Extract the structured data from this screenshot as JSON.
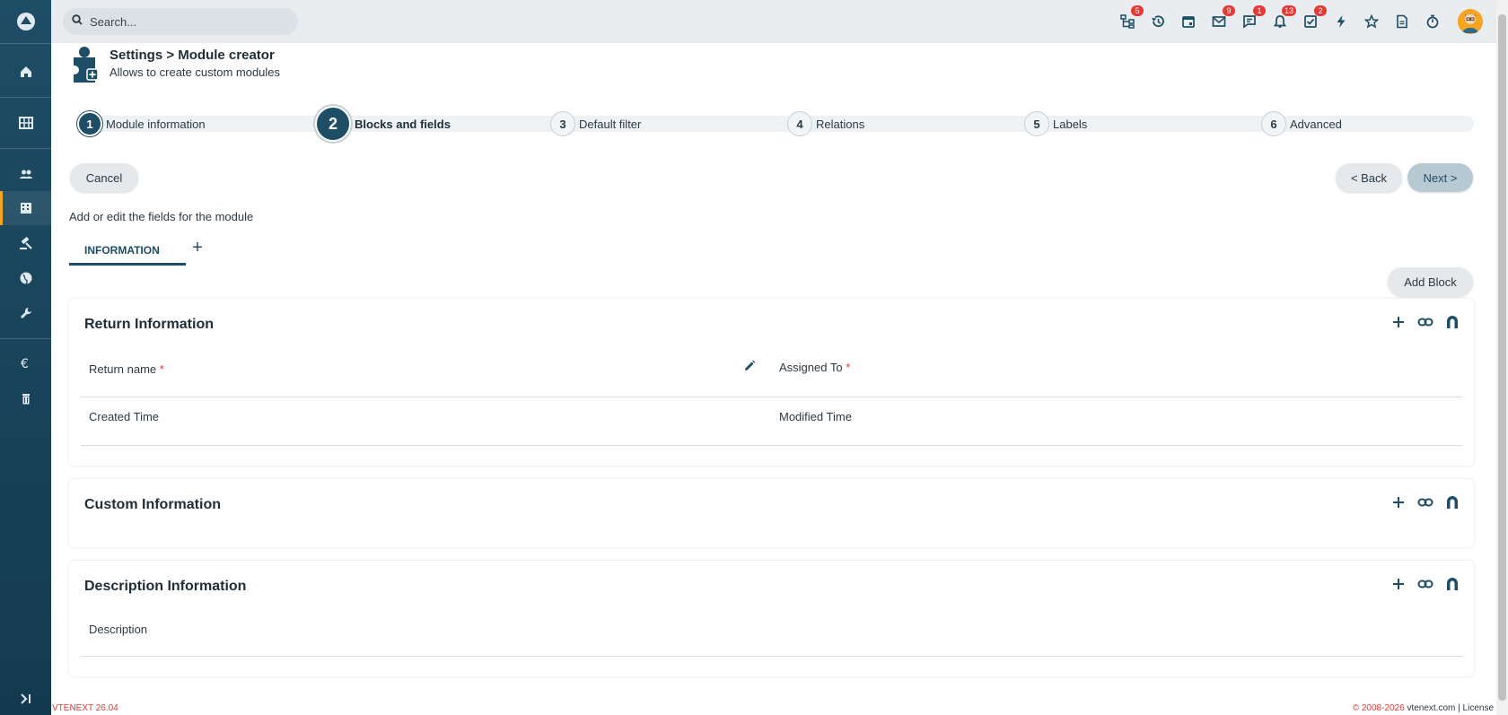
{
  "topbar": {
    "search_placeholder": "Search...",
    "icons": [
      {
        "name": "org-chart-icon",
        "badge": "5"
      },
      {
        "name": "history-icon",
        "badge": ""
      },
      {
        "name": "calendar-icon",
        "badge": ""
      },
      {
        "name": "mail-icon",
        "badge": "9"
      },
      {
        "name": "chat-icon",
        "badge": "1"
      },
      {
        "name": "bell-icon",
        "badge": "13"
      },
      {
        "name": "task-check-icon",
        "badge": "2"
      },
      {
        "name": "lightning-icon",
        "badge": ""
      },
      {
        "name": "star-icon",
        "badge": ""
      },
      {
        "name": "document-icon",
        "badge": ""
      },
      {
        "name": "stopwatch-icon",
        "badge": ""
      }
    ]
  },
  "sidebar": {
    "items": [
      "home-icon",
      "grid-icon",
      "users-icon",
      "building-icon",
      "gavel-icon",
      "globe-icon",
      "wrench-icon",
      "euro-icon",
      "trash-icon",
      "expand-icon"
    ]
  },
  "header": {
    "title": "Settings > Module creator",
    "subtitle": "Allows to create custom modules"
  },
  "steps": [
    {
      "num": "1",
      "label": "Module information"
    },
    {
      "num": "2",
      "label": "Blocks and fields"
    },
    {
      "num": "3",
      "label": "Default filter"
    },
    {
      "num": "4",
      "label": "Relations"
    },
    {
      "num": "5",
      "label": "Labels"
    },
    {
      "num": "6",
      "label": "Advanced"
    }
  ],
  "buttons": {
    "cancel": "Cancel",
    "back": "< Back",
    "next": "Next >",
    "add_block": "Add Block"
  },
  "intro": "Add or edit the fields for the module",
  "tabs": {
    "active": "INFORMATION",
    "add": "+"
  },
  "blocks": [
    {
      "title": "Return Information",
      "fields": [
        {
          "label": "Return name",
          "required": "*"
        },
        {
          "label": "Assigned To",
          "required": "*"
        },
        {
          "label": "Created Time",
          "required": ""
        },
        {
          "label": "Modified Time",
          "required": ""
        }
      ]
    },
    {
      "title": "Custom Information",
      "fields": []
    },
    {
      "title": "Description Information",
      "fields": [
        {
          "label": "Description",
          "required": ""
        }
      ]
    }
  ],
  "footer": {
    "version": "VTENEXT 26.04",
    "copyright": "© 2008-2026",
    "site": "vtenext.com",
    "separator": "|",
    "license": "License"
  },
  "colors": {
    "primary": "#1e4d66",
    "accent": "#f4a623",
    "badge": "#e53935"
  }
}
